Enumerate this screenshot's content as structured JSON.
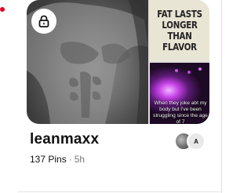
{
  "board": {
    "title": "leanmaxx",
    "pins": "137 Pins",
    "separator": "·",
    "updated": "5h",
    "secret_icon": "lock-icon",
    "collage": {
      "top_right_text": "FAT LASTS\nLONGER\nTHAN\nFLAVOR",
      "bottom_right_caption": "When they joke abt my body but I've been struggling since the age of 7"
    },
    "collaborators": [
      {
        "type": "photo"
      },
      {
        "initial": "A"
      }
    ]
  },
  "colors": {
    "notification_dot": "#e60023",
    "text_primary": "#111111",
    "text_secondary": "#767676"
  }
}
